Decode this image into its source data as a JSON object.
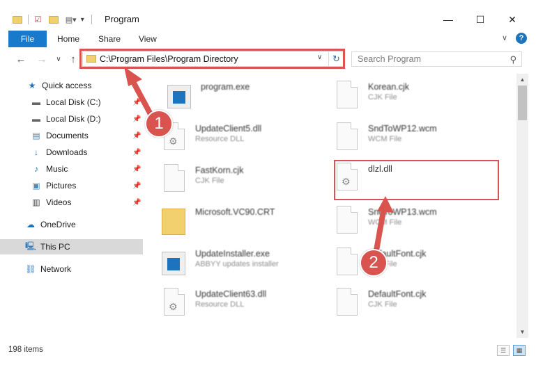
{
  "window": {
    "title": "Program",
    "minimize_glyph": "—",
    "maximize_glyph": "☐",
    "close_glyph": "✕"
  },
  "ribbon": {
    "tabs": [
      "File",
      "Home",
      "Share",
      "View"
    ],
    "expand_glyph": "∨",
    "help_glyph": "?"
  },
  "nav": {
    "back_glyph": "←",
    "forward_glyph": "→",
    "recent_glyph": "∨",
    "up_glyph": "↑",
    "address": "C:\\Program Files\\Program Directory",
    "search_placeholder": "Search Program"
  },
  "sidebar": {
    "items": [
      {
        "label": "Quick access",
        "icon": "star-icon"
      },
      {
        "label": "Local Disk (C:)",
        "icon": "drive-icon",
        "pinned": true
      },
      {
        "label": "Local Disk (D:)",
        "icon": "drive-icon",
        "pinned": true
      },
      {
        "label": "Documents",
        "icon": "documents-icon",
        "pinned": true
      },
      {
        "label": "Downloads",
        "icon": "downloads-icon",
        "pinned": true
      },
      {
        "label": "Music",
        "icon": "music-icon",
        "pinned": true
      },
      {
        "label": "Pictures",
        "icon": "pictures-icon",
        "pinned": true
      },
      {
        "label": "Videos",
        "icon": "videos-icon",
        "pinned": true
      },
      {
        "label": "OneDrive",
        "icon": "cloud-icon"
      },
      {
        "label": "This PC",
        "icon": "computer-icon",
        "selected": true
      },
      {
        "label": "Network",
        "icon": "network-icon"
      }
    ]
  },
  "files": {
    "left": [
      {
        "name": "program.exe",
        "type": "",
        "icon": "exe-icon"
      },
      {
        "name": "UpdateClient5.dll",
        "type": "Resource DLL",
        "icon": "dll-icon"
      },
      {
        "name": "FastKorn.cjk",
        "type": "CJK File",
        "icon": "document-icon"
      },
      {
        "name": "Microsoft.VC90.CRT",
        "type": "",
        "icon": "folder-icon"
      },
      {
        "name": "UpdateInstaller.exe",
        "type": "ABBYY updates installer",
        "icon": "exe-icon"
      },
      {
        "name": "UpdateClient63.dll",
        "type": "Resource DLL",
        "icon": "dll-icon"
      }
    ],
    "right": [
      {
        "name": "Korean.cjk",
        "type": "CJK File",
        "icon": "document-icon"
      },
      {
        "name": "SndToWP12.wcm",
        "type": "WCM File",
        "icon": "document-icon"
      },
      {
        "name": "dlzl.dll",
        "type": "",
        "icon": "dll-icon"
      },
      {
        "name": "SndToWP13.wcm",
        "type": "WCM File",
        "icon": "document-icon"
      },
      {
        "name": "DefaultFont.cjk",
        "type": "CJK File",
        "icon": "document-icon"
      },
      {
        "name": "DefaultFont.cjk",
        "type": "CJK File",
        "icon": "document-icon"
      }
    ]
  },
  "status": {
    "items_count": "198 items"
  },
  "annotations": {
    "step1": "1",
    "step2": "2",
    "color": "#d9534f"
  }
}
